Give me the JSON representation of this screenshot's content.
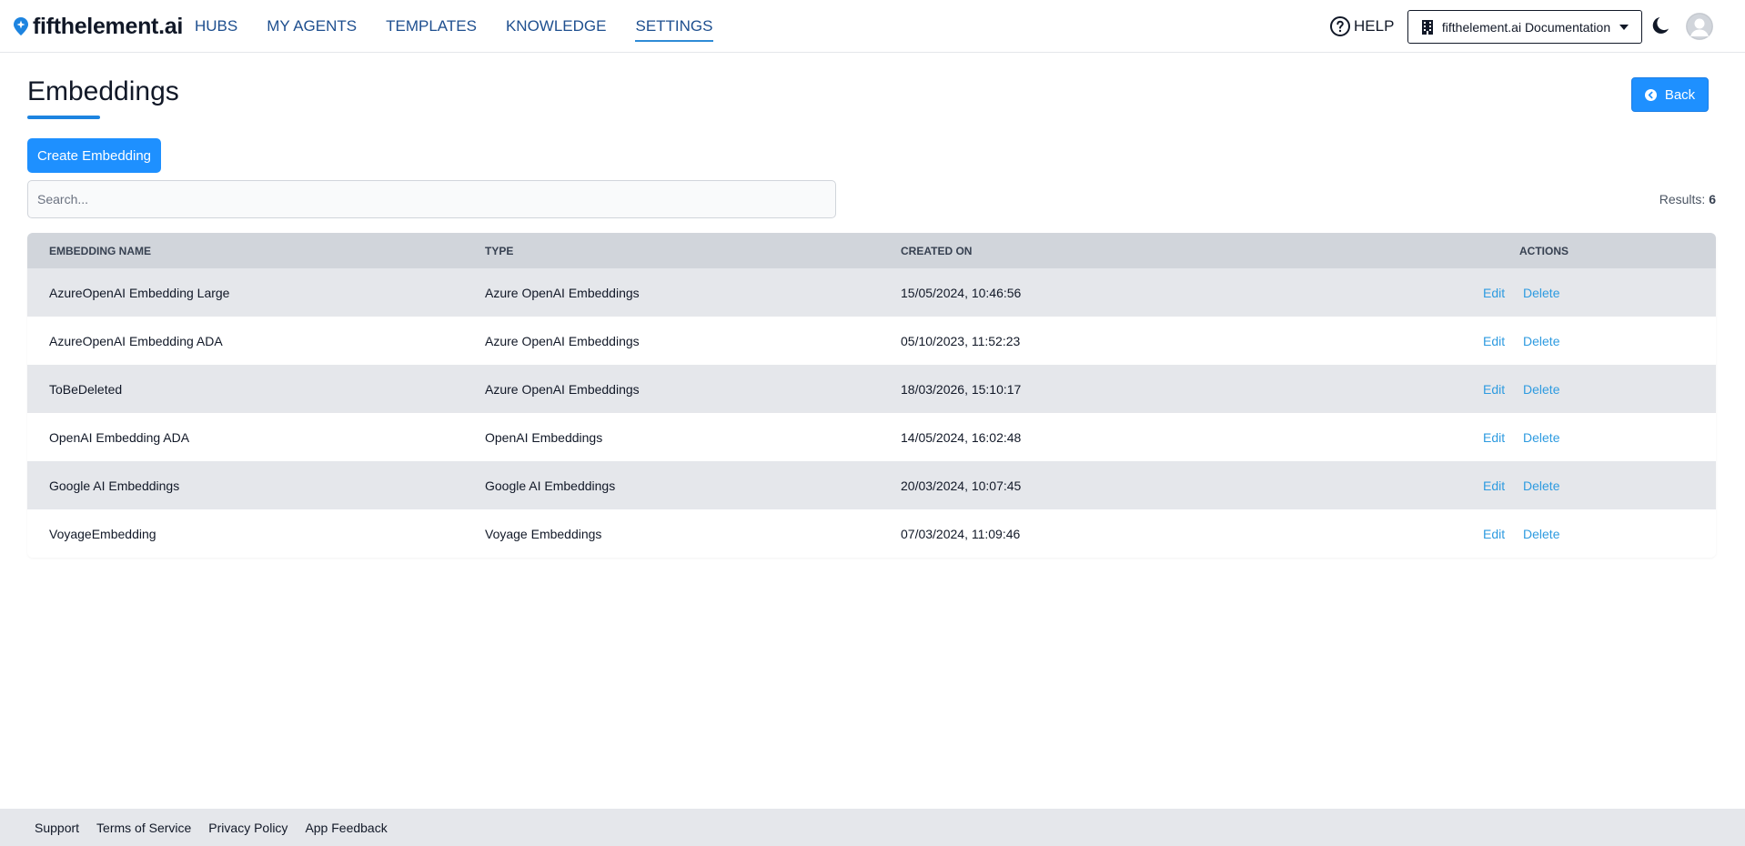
{
  "brand": {
    "name": "fifthelement.ai",
    "accent": "#1e90ff"
  },
  "nav": {
    "items": [
      {
        "label": "HUBS"
      },
      {
        "label": "MY AGENTS"
      },
      {
        "label": "TEMPLATES"
      },
      {
        "label": "KNOWLEDGE"
      },
      {
        "label": "SETTINGS",
        "active": true
      }
    ],
    "help_label": "HELP",
    "hub_label": "fifthelement.ai Documentation"
  },
  "page": {
    "title": "Embeddings",
    "back_label": "Back",
    "create_label": "Create Embedding",
    "search_placeholder": "Search...",
    "results_label": "Results:",
    "results_count": "6"
  },
  "table": {
    "headers": {
      "name": "EMBEDDING NAME",
      "type": "TYPE",
      "created": "CREATED ON",
      "actions": "ACTIONS"
    },
    "edit_label": "Edit",
    "delete_label": "Delete",
    "rows": [
      {
        "name": "AzureOpenAI Embedding Large",
        "type": "Azure OpenAI Embeddings",
        "created": "15/05/2024, 10:46:56"
      },
      {
        "name": "AzureOpenAI Embedding ADA",
        "type": "Azure OpenAI Embeddings",
        "created": "05/10/2023, 11:52:23"
      },
      {
        "name": "ToBeDeleted",
        "type": "Azure OpenAI Embeddings",
        "created": "18/03/2026, 15:10:17"
      },
      {
        "name": "OpenAI Embedding ADA",
        "type": "OpenAI Embeddings",
        "created": "14/05/2024, 16:02:48"
      },
      {
        "name": "Google AI Embeddings",
        "type": "Google AI Embeddings",
        "created": "20/03/2024, 10:07:45"
      },
      {
        "name": "VoyageEmbedding",
        "type": "Voyage Embeddings",
        "created": "07/03/2024, 11:09:46"
      }
    ]
  },
  "footer": {
    "links": [
      {
        "label": "Support"
      },
      {
        "label": "Terms of Service"
      },
      {
        "label": "Privacy Policy"
      },
      {
        "label": "App Feedback"
      }
    ]
  }
}
